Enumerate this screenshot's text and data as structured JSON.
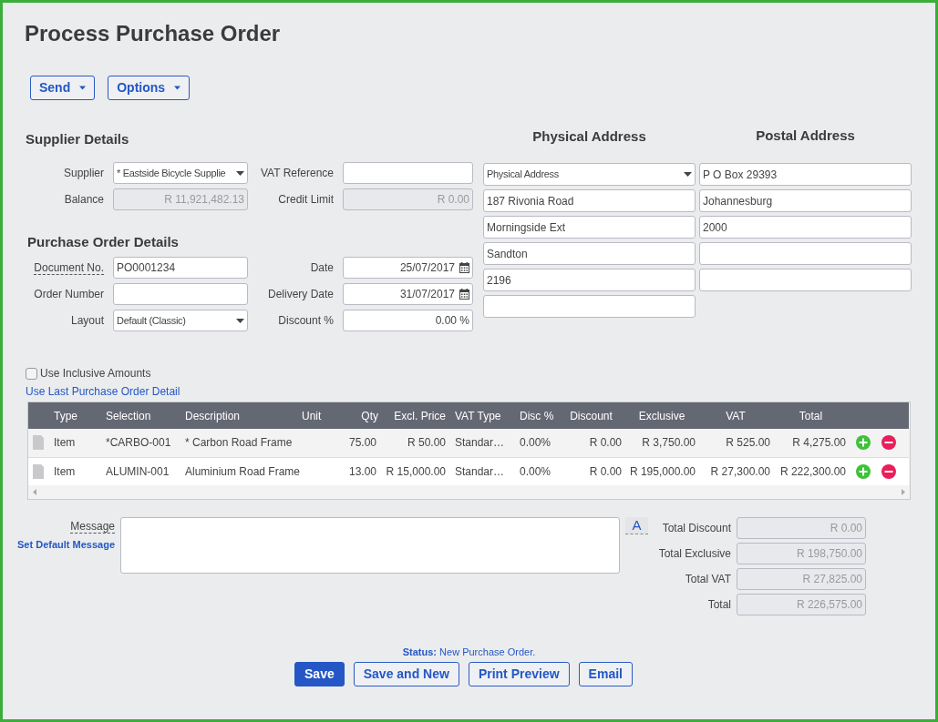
{
  "title": "Process Purchase Order",
  "toolbar": [
    {
      "label": "Send"
    },
    {
      "label": "Options"
    }
  ],
  "supplier_details": {
    "heading": "Supplier Details",
    "fields": [
      {
        "label": "Supplier",
        "kind": "dropdown",
        "value": "* Eastside Bicycle Supplie",
        "tooltip": false
      },
      {
        "label": "VAT Reference",
        "kind": "text",
        "tooltip": false
      },
      {
        "label": "Balance",
        "kind": "readonly",
        "value": "R 11,921,482.13",
        "tooltip": false
      },
      {
        "label": "Credit Limit",
        "kind": "readonly",
        "value": "R 0.00",
        "tooltip": false
      }
    ]
  },
  "order_details": {
    "heading": "Purchase Order Details",
    "fields": [
      {
        "label": "Document No.",
        "kind": "text",
        "value": "PO0001234",
        "tooltip": true
      },
      {
        "label": "Date",
        "kind": "date",
        "value": "25/07/2017",
        "tooltip": false
      },
      {
        "label": "Order Number",
        "kind": "text",
        "tooltip": false
      },
      {
        "label": "Delivery Date",
        "kind": "date",
        "value": "31/07/2017",
        "tooltip": false
      },
      {
        "label": "Layout",
        "kind": "dropdown",
        "value": "Default (Classic)",
        "tooltip": false
      },
      {
        "label": "Discount %",
        "kind": "number",
        "value": "0.00 %",
        "tooltip": false
      }
    ]
  },
  "physical_address": {
    "heading": "Physical Address",
    "lines": [
      {
        "kind": "dropdown",
        "value": "Physical Address"
      },
      {
        "kind": "text",
        "value": "187 Rivonia Road"
      },
      {
        "kind": "text",
        "value": "Morningside Ext"
      },
      {
        "kind": "text",
        "value": "Sandton"
      },
      {
        "kind": "text",
        "value": "2196"
      },
      {
        "kind": "text"
      }
    ]
  },
  "postal_address": {
    "heading": "Postal Address",
    "lines": [
      {
        "kind": "text",
        "value": "P O Box 29393"
      },
      {
        "kind": "text",
        "value": "Johannesburg"
      },
      {
        "kind": "text",
        "value": "2000"
      },
      {
        "kind": "text"
      },
      {
        "kind": "text"
      }
    ]
  },
  "use_inclusive_amounts": {
    "label": "Use Inclusive Amounts",
    "checked": false
  },
  "use_last_link": "Use Last Purchase Order Detail",
  "table": {
    "columns": [
      "Type",
      "Selection",
      "Description",
      "Unit",
      "Qty",
      "Excl. Price",
      "VAT Type",
      "Disc %",
      "Discount",
      "Exclusive",
      "VAT",
      "Total"
    ],
    "rows": [
      {
        "selected": true,
        "cells": [
          "Item",
          "*CARBO-001",
          "* Carbon Road Frame",
          "",
          "75.00",
          "R 50.00",
          "Standar…",
          "0.00%",
          "R 0.00",
          "R 3,750.00",
          "R 525.00",
          "R 4,275.00"
        ]
      },
      {
        "selected": false,
        "cells": [
          "Item",
          "ALUMIN-001",
          "Aluminium Road Frame",
          "",
          "13.00",
          "R 15,000.00",
          "Standar…",
          "0.00%",
          "R 0.00",
          "R 195,000.00",
          "R 27,300.00",
          "R 222,300.00"
        ]
      }
    ]
  },
  "message": {
    "label": "Message",
    "tooltip": true,
    "link": "Set Default Message",
    "font_button": "A"
  },
  "totals": [
    {
      "label": "Total Discount",
      "value": "R 0.00"
    },
    {
      "label": "Total Exclusive",
      "value": "R 198,750.00"
    },
    {
      "label": "Total VAT",
      "value": "R 27,825.00"
    },
    {
      "label": "Total",
      "value": "R 226,575.00"
    }
  ],
  "status": {
    "label": "Status:",
    "value": "New Purchase Order."
  },
  "actions": [
    {
      "label": "Save",
      "primary": true
    },
    {
      "label": "Save and New",
      "primary": false
    },
    {
      "label": "Print Preview",
      "primary": false
    },
    {
      "label": "Email",
      "primary": false
    }
  ]
}
